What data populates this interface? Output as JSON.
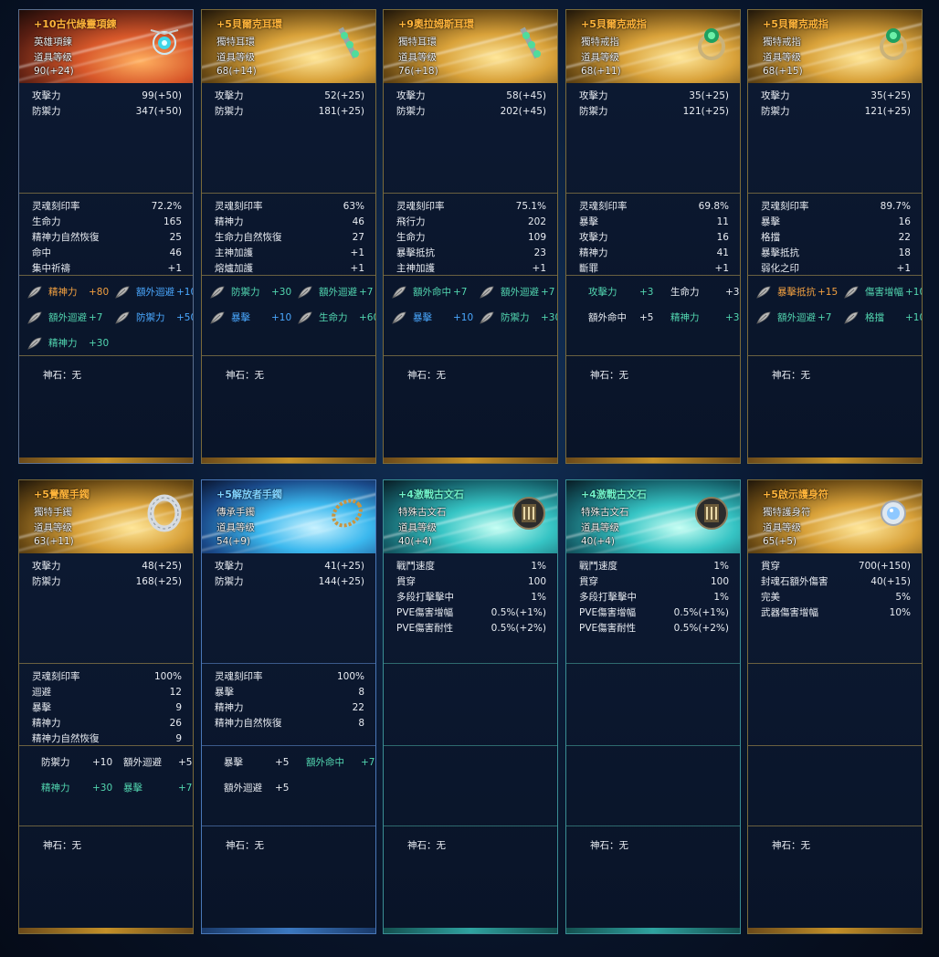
{
  "god_stone_label": "神石：无",
  "cards": [
    {
      "theme": "orange",
      "name": "+10古代綠靈項鍊",
      "type": "英雄項鍊",
      "level_label": "道具等级",
      "level": "90(+24)",
      "icon": "necklace-icon",
      "base": [
        {
          "k": "攻擊力",
          "v": "99(+50)"
        },
        {
          "k": "防禦力",
          "v": "347(+50)"
        }
      ],
      "sub": [
        {
          "k": "灵魂刻印率",
          "v": "72.2%"
        },
        {
          "k": "生命力",
          "v": "165"
        },
        {
          "k": "精神力自然恢復",
          "v": "25"
        },
        {
          "k": "命中",
          "v": "46"
        },
        {
          "k": "集中祈禱",
          "v": "+1"
        }
      ],
      "opts": [
        {
          "name": "精神力",
          "val": "+80",
          "color": "orange",
          "icon": true
        },
        {
          "name": "額外迴避",
          "val": "+10",
          "color": "blue",
          "icon": true
        },
        {
          "name": "額外迴避",
          "val": "+7",
          "color": "teal",
          "icon": true
        },
        {
          "name": "防禦力",
          "val": "+50",
          "color": "blue",
          "icon": true
        },
        {
          "name": "精神力",
          "val": "+30",
          "color": "teal",
          "icon": true
        }
      ]
    },
    {
      "theme": "gold",
      "name": "+5貝爾克耳環",
      "type": "獨特耳環",
      "level_label": "道具等级",
      "level": "68(+14)",
      "icon": "earring-icon",
      "base": [
        {
          "k": "攻擊力",
          "v": "52(+25)"
        },
        {
          "k": "防禦力",
          "v": "181(+25)"
        }
      ],
      "sub": [
        {
          "k": "灵魂刻印率",
          "v": "63%"
        },
        {
          "k": "精神力",
          "v": "46"
        },
        {
          "k": "生命力自然恢復",
          "v": "27"
        },
        {
          "k": "主神加護",
          "v": "+1"
        },
        {
          "k": "熔爐加護",
          "v": "+1"
        }
      ],
      "opts": [
        {
          "name": "防禦力",
          "val": "+30",
          "color": "teal",
          "icon": true
        },
        {
          "name": "額外迴避",
          "val": "+7",
          "color": "teal",
          "icon": true
        },
        {
          "name": "暴擊",
          "val": "+10",
          "color": "blue",
          "icon": true
        },
        {
          "name": "生命力",
          "val": "+60",
          "color": "teal",
          "icon": true
        }
      ]
    },
    {
      "theme": "gold",
      "name": "+9奧拉姆斯耳環",
      "type": "獨特耳環",
      "level_label": "道具等级",
      "level": "76(+18)",
      "icon": "earring-icon",
      "base": [
        {
          "k": "攻擊力",
          "v": "58(+45)"
        },
        {
          "k": "防禦力",
          "v": "202(+45)"
        }
      ],
      "sub": [
        {
          "k": "灵魂刻印率",
          "v": "75.1%"
        },
        {
          "k": "飛行力",
          "v": "202"
        },
        {
          "k": "生命力",
          "v": "109"
        },
        {
          "k": "暴擊抵抗",
          "v": "23"
        },
        {
          "k": "主神加護",
          "v": "+1"
        }
      ],
      "opts": [
        {
          "name": "額外命中",
          "val": "+7",
          "color": "teal",
          "icon": true
        },
        {
          "name": "額外迴避",
          "val": "+7",
          "color": "teal",
          "icon": true
        },
        {
          "name": "暴擊",
          "val": "+10",
          "color": "blue",
          "icon": true
        },
        {
          "name": "防禦力",
          "val": "+30",
          "color": "teal",
          "icon": true
        }
      ]
    },
    {
      "theme": "gold",
      "name": "+5貝爾克戒指",
      "type": "獨特戒指",
      "level_label": "道具等级",
      "level": "68(+11)",
      "icon": "ring-green-icon",
      "base": [
        {
          "k": "攻擊力",
          "v": "35(+25)"
        },
        {
          "k": "防禦力",
          "v": "121(+25)"
        }
      ],
      "sub": [
        {
          "k": "灵魂刻印率",
          "v": "69.8%"
        },
        {
          "k": "暴擊",
          "v": "11"
        },
        {
          "k": "攻擊力",
          "v": "16"
        },
        {
          "k": "精神力",
          "v": "41"
        },
        {
          "k": "斷罪",
          "v": "+1"
        }
      ],
      "opts": [
        {
          "name": "攻擊力",
          "val": "+3",
          "color": "teal",
          "icon": false
        },
        {
          "name": "生命力",
          "val": "+30",
          "color": "white",
          "icon": false
        },
        {
          "name": "額外命中",
          "val": "+5",
          "color": "white",
          "icon": false
        },
        {
          "name": "精神力",
          "val": "+30",
          "color": "teal",
          "icon": false
        }
      ]
    },
    {
      "theme": "gold",
      "name": "+5貝爾克戒指",
      "type": "獨特戒指",
      "level_label": "道具等级",
      "level": "68(+15)",
      "icon": "ring-green-icon",
      "base": [
        {
          "k": "攻擊力",
          "v": "35(+25)"
        },
        {
          "k": "防禦力",
          "v": "121(+25)"
        }
      ],
      "sub": [
        {
          "k": "灵魂刻印率",
          "v": "89.7%"
        },
        {
          "k": "暴擊",
          "v": "16"
        },
        {
          "k": "格擋",
          "v": "22"
        },
        {
          "k": "暴擊抵抗",
          "v": "18"
        },
        {
          "k": "弱化之印",
          "v": "+1"
        }
      ],
      "opts": [
        {
          "name": "暴擊抵抗",
          "val": "+15",
          "color": "orange",
          "icon": true
        },
        {
          "name": "傷害增幅",
          "val": "+10",
          "color": "teal",
          "icon": true
        },
        {
          "name": "額外迴避",
          "val": "+7",
          "color": "teal",
          "icon": true
        },
        {
          "name": "格擋",
          "val": "+10",
          "color": "teal",
          "icon": true
        }
      ]
    },
    {
      "theme": "gold",
      "name": "+5覺醒手鐲",
      "type": "獨特手鐲",
      "level_label": "道具等级",
      "level": "63(+11)",
      "icon": "bracelet-silver-icon",
      "base": [
        {
          "k": "攻擊力",
          "v": "48(+25)"
        },
        {
          "k": "防禦力",
          "v": "168(+25)"
        }
      ],
      "sub": [
        {
          "k": "灵魂刻印率",
          "v": "100%"
        },
        {
          "k": "迴避",
          "v": "12"
        },
        {
          "k": "暴擊",
          "v": "9"
        },
        {
          "k": "精神力",
          "v": "26"
        },
        {
          "k": "精神力自然恢復",
          "v": "9"
        }
      ],
      "opts": [
        {
          "name": "防禦力",
          "val": "+10",
          "color": "white",
          "icon": false
        },
        {
          "name": "額外迴避",
          "val": "+5",
          "color": "white",
          "icon": false
        },
        {
          "name": "精神力",
          "val": "+30",
          "color": "teal",
          "icon": false
        },
        {
          "name": "暴擊",
          "val": "+7",
          "color": "teal",
          "icon": false
        }
      ]
    },
    {
      "theme": "blue",
      "name": "+5解放者手鐲",
      "type": "傳承手鐲",
      "level_label": "道具等级",
      "level": "54(+9)",
      "icon": "bracelet-gold-icon",
      "base": [
        {
          "k": "攻擊力",
          "v": "41(+25)"
        },
        {
          "k": "防禦力",
          "v": "144(+25)"
        }
      ],
      "sub": [
        {
          "k": "灵魂刻印率",
          "v": "100%"
        },
        {
          "k": "暴擊",
          "v": "8"
        },
        {
          "k": "精神力",
          "v": "22"
        },
        {
          "k": "精神力自然恢復",
          "v": "8"
        }
      ],
      "opts": [
        {
          "name": "暴擊",
          "val": "+5",
          "color": "white",
          "icon": false
        },
        {
          "name": "額外命中",
          "val": "+7",
          "color": "teal",
          "icon": false
        },
        {
          "name": "額外迴避",
          "val": "+5",
          "color": "white",
          "icon": false
        }
      ]
    },
    {
      "theme": "teal",
      "name": "+4激戰古文石",
      "type": "特殊古文石",
      "level_label": "道具等级",
      "level": "40(+4)",
      "icon": "rune-stone-icon",
      "base": [
        {
          "k": "戰鬥速度",
          "v": "1%"
        },
        {
          "k": "貫穿",
          "v": "100"
        },
        {
          "k": "多段打擊擊中",
          "v": "1%"
        },
        {
          "k": "PVE傷害增幅",
          "v": "0.5%(+1%)"
        },
        {
          "k": "PVE傷害耐性",
          "v": "0.5%(+2%)"
        }
      ],
      "sub": [],
      "opts": []
    },
    {
      "theme": "teal",
      "name": "+4激戰古文石",
      "type": "特殊古文石",
      "level_label": "道具等级",
      "level": "40(+4)",
      "icon": "rune-stone-icon",
      "base": [
        {
          "k": "戰鬥速度",
          "v": "1%"
        },
        {
          "k": "貫穿",
          "v": "100"
        },
        {
          "k": "多段打擊擊中",
          "v": "1%"
        },
        {
          "k": "PVE傷害增幅",
          "v": "0.5%(+1%)"
        },
        {
          "k": "PVE傷害耐性",
          "v": "0.5%(+2%)"
        }
      ],
      "sub": [],
      "opts": []
    },
    {
      "theme": "gold",
      "name": "+5啟示護身符",
      "type": "獨特護身符",
      "level_label": "道具等级",
      "level": "65(+5)",
      "icon": "amulet-icon",
      "base": [
        {
          "k": "貫穿",
          "v": "700(+150)"
        },
        {
          "k": "封魂石額外傷害",
          "v": "40(+15)"
        },
        {
          "k": "完美",
          "v": "5%"
        },
        {
          "k": "武器傷害增幅",
          "v": "10%"
        }
      ],
      "sub": [],
      "opts": []
    }
  ]
}
